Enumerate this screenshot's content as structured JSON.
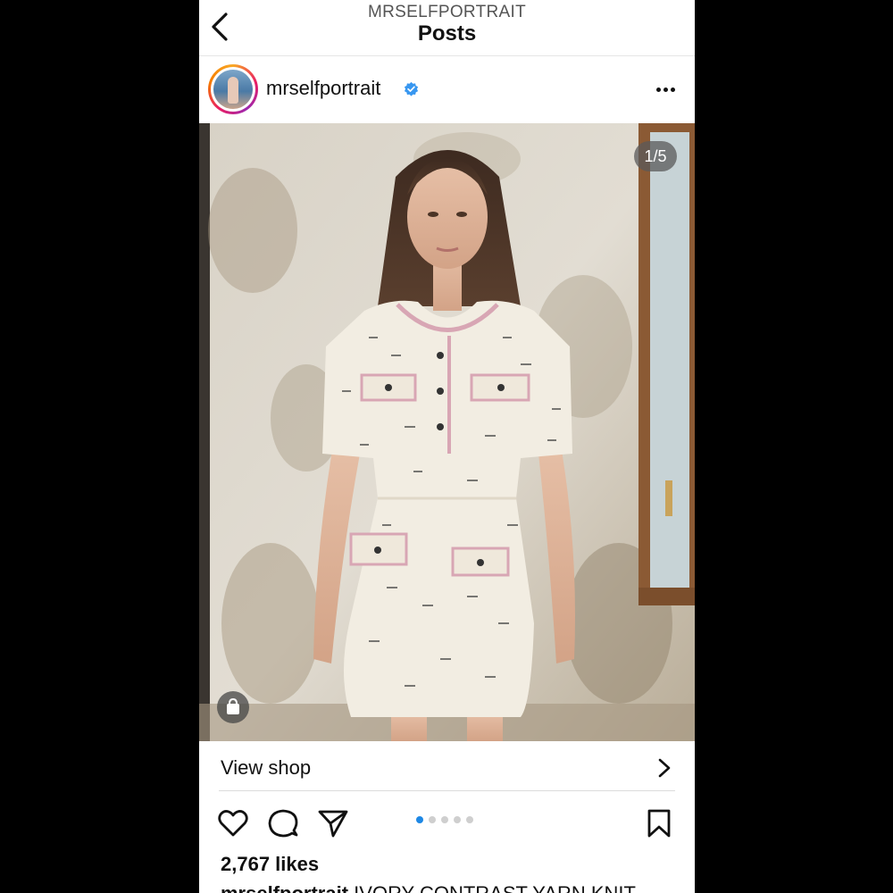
{
  "header": {
    "account_handle_upper": "MRSELFPORTRAIT",
    "title": "Posts"
  },
  "post": {
    "username": "mrselfportrait",
    "verified": true,
    "image_counter": "1/5",
    "carousel_total": 5,
    "carousel_active": 1,
    "view_shop_label": "View shop",
    "likes": "2,767 likes",
    "caption_username": "mrselfportrait",
    "caption_text": "IVORY CONTRAST YARN KNIT"
  },
  "icons": {
    "back": "chevron-left-icon",
    "verified": "verified-badge-icon",
    "more": "more-horizontal-icon",
    "shop_tag": "shopping-bag-icon",
    "chevron": "chevron-right-icon",
    "like": "heart-icon",
    "comment": "comment-icon",
    "share": "send-icon",
    "save": "bookmark-icon"
  },
  "colors": {
    "accent_blue": "#1e88e5",
    "verified_blue": "#3897f0",
    "background": "#000000"
  }
}
